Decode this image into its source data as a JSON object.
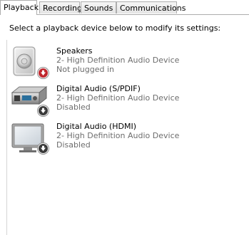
{
  "tabs": [
    {
      "label": "Playback"
    },
    {
      "label": "Recording"
    },
    {
      "label": "Sounds"
    },
    {
      "label": "Communications"
    }
  ],
  "instruction": "Select a playback device below to modify its settings:",
  "devices": [
    {
      "name": "Speakers",
      "description": "2- High Definition Audio Device",
      "status": "Not plugged in",
      "icon": "speaker-icon",
      "badge": "unplugged-red-icon"
    },
    {
      "name": "Digital Audio (S/PDIF)",
      "description": "2- High Definition Audio Device",
      "status": "Disabled",
      "icon": "digital-audio-receiver-icon",
      "badge": "disabled-dark-icon"
    },
    {
      "name": "Digital Audio (HDMI)",
      "description": "2- High Definition Audio Device",
      "status": "Disabled",
      "icon": "monitor-icon",
      "badge": "disabled-dark-icon"
    }
  ],
  "colors": {
    "unplugged_badge": "#c0272d",
    "disabled_badge": "#3a3a3a",
    "secondary_text": "#6d6d6d"
  }
}
